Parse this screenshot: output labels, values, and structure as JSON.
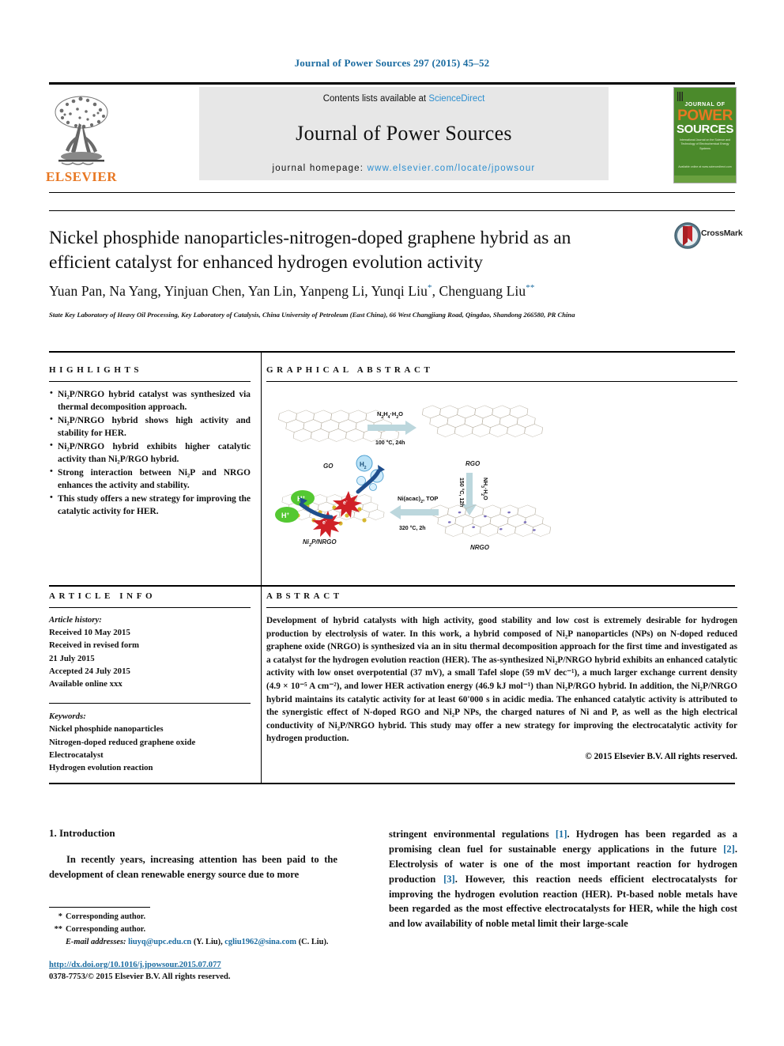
{
  "running_head": "Journal of Power Sources 297 (2015) 45–52",
  "masthead": {
    "publisher": "ELSEVIER",
    "contents_prefix": "Contents lists available at ",
    "contents_link": "ScienceDirect",
    "journal_title": "Journal of Power Sources",
    "homepage_label": "journal homepage: ",
    "homepage_url": "www.elsevier.com/locate/jpowsour",
    "cover": {
      "line1": "JOURNAL OF",
      "line2": "POWER",
      "line3": "SOURCES",
      "blurb": "International Journal on the Science and Technology of Electrochemical Energy Systems",
      "footer": "Available online at www.sciencedirect.com"
    }
  },
  "article": {
    "title": "Nickel phosphide nanoparticles-nitrogen-doped graphene hybrid as an efficient catalyst for enhanced hydrogen evolution activity",
    "crossmark_label": "CrossMark",
    "authors": "Yuan Pan, Na Yang, Yinjuan Chen, Yan Lin, Yanpeng Li, Yunqi Liu",
    "authors_tail": ", Chenguang Liu",
    "affiliation": "State Key Laboratory of Heavy Oil Processing, Key Laboratory of Catalysis, China University of Petroleum (East China), 66 West Changjiang Road, Qingdao, Shandong 266580, PR China"
  },
  "highlights": {
    "heading": "HIGHLIGHTS",
    "items": [
      "Ni₂P/NRGO hybrid catalyst was synthesized via thermal decomposition approach.",
      "Ni₂P/NRGO hybrid shows high activity and stability for HER.",
      "Ni₂P/NRGO hybrid exhibits higher catalytic activity than Ni₂P/RGO hybrid.",
      "Strong interaction between Ni₂P and NRGO enhances the activity and stability.",
      "This study offers a new strategy for improving the catalytic activity for HER."
    ]
  },
  "graphical_abstract": {
    "heading": "GRAPHICAL ABSTRACT",
    "nodes": [
      {
        "id": "go",
        "label": "GO"
      },
      {
        "id": "rgo",
        "label": "RGO"
      },
      {
        "id": "nrgo",
        "label": "NRGO"
      },
      {
        "id": "ni2p_nrgo",
        "label": "Ni₂P/NRGO"
      }
    ],
    "arrows": [
      {
        "id": "go-to-rgo",
        "reagent": "N₂H₄·H₂O",
        "condition": "100 °C, 24h"
      },
      {
        "id": "rgo-to-nrgo",
        "reagent": "NH₃·H₂O",
        "condition": "150 °C, 12h"
      },
      {
        "id": "nrgo-to-ni2p",
        "reagent": "Ni(acac)₂, TOP",
        "condition": "320 °C, 2h"
      }
    ],
    "species": [
      {
        "id": "proton-1",
        "label": "H⁺"
      },
      {
        "id": "proton-2",
        "label": "H⁺"
      },
      {
        "id": "electron-1",
        "label": "e⁻"
      },
      {
        "id": "electron-2",
        "label": "e⁻"
      },
      {
        "id": "dihydrogen",
        "label": "H₂"
      }
    ]
  },
  "article_info": {
    "heading": "ARTICLE INFO",
    "history_label": "Article history:",
    "history": [
      "Received 10 May 2015",
      "Received in revised form",
      "21 July 2015",
      "Accepted 24 July 2015",
      "Available online xxx"
    ],
    "keywords_label": "Keywords:",
    "keywords": [
      "Nickel phosphide nanoparticles",
      "Nitrogen-doped reduced graphene oxide",
      "Electrocatalyst",
      "Hydrogen evolution reaction"
    ]
  },
  "abstract": {
    "heading": "ABSTRACT",
    "text": "Development of hybrid catalysts with high activity, good stability and low cost is extremely desirable for hydrogen production by electrolysis of water. In this work, a hybrid composed of Ni₂P nanoparticles (NPs) on N-doped reduced graphene oxide (NRGO) is synthesized via an in situ thermal decomposition approach for the first time and investigated as a catalyst for the hydrogen evolution reaction (HER). The as-synthesized Ni₂P/NRGO hybrid exhibits an enhanced catalytic activity with low onset overpotential (37 mV), a small Tafel slope (59 mV dec⁻¹), a much larger exchange current density (4.9 × 10⁻⁵ A cm⁻²), and lower HER activation energy (46.9 kJ mol⁻¹) than Ni₂P/RGO hybrid. In addition, the Ni₂P/NRGO hybrid maintains its catalytic activity for at least 60'000 s in acidic media. The enhanced catalytic activity is attributed to the synergistic effect of N-doped RGO and Ni₂P NPs, the charged natures of Ni and P, as well as the high electrical conductivity of Ni₂P/NRGO hybrid. This study may offer a new strategy for improving the electrocatalytic activity for hydrogen production.",
    "copyright": "© 2015 Elsevier B.V. All rights reserved."
  },
  "body": {
    "section_number_title": "1. Introduction",
    "left_paragraph": "In recently years, increasing attention has been paid to the development of clean renewable energy source due to more",
    "right_paragraph_parts": [
      "stringent environmental regulations ",
      "[1]",
      ". Hydrogen has been regarded as a promising clean fuel for sustainable energy applications in the future ",
      "[2]",
      ". Electrolysis of water is one of the most important reaction for hydrogen production ",
      "[3]",
      ". However, this reaction needs efficient electrocatalysts for improving the hydrogen evolution reaction (HER). Pt-based noble metals have been regarded as the most effective electrocatalysts for HER, while the high cost and low availability of noble metal limit their large-scale"
    ]
  },
  "footnotes": {
    "corresponding_1": "Corresponding author.",
    "corresponding_2": "Corresponding author.",
    "email_label": "E-mail addresses:",
    "email_1": "liuyq@upc.edu.cn",
    "email_1_owner": "(Y. Liu),",
    "email_2": "cgliu1962@sina.com",
    "email_2_owner": "(C. Liu).",
    "doi": "http://dx.doi.org/10.1016/j.jpowsour.2015.07.077",
    "issn_line": "0378-7753/© 2015 Elsevier B.V. All rights reserved."
  },
  "colors": {
    "link": "#1a6ba0",
    "elsevier_orange": "#E87722",
    "cover_green": "#4b8a2b",
    "sciencedirect_blue": "#2d8fd0"
  }
}
